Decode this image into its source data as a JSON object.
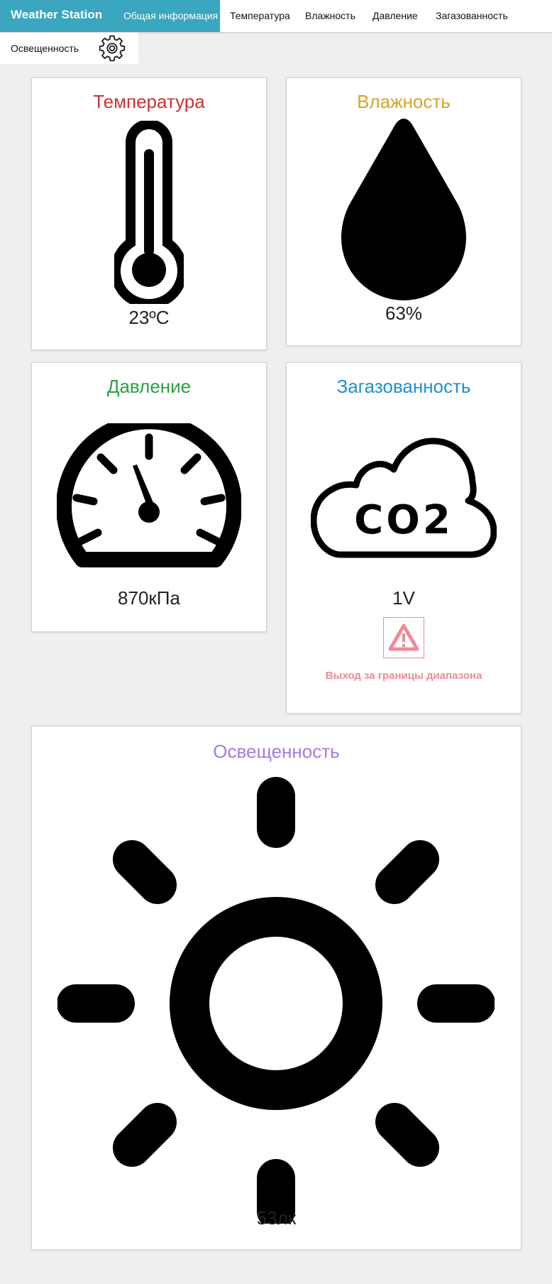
{
  "header": {
    "brand": "Weather Station",
    "nav": [
      {
        "label": "Общая информация",
        "active": true
      },
      {
        "label": "Температура"
      },
      {
        "label": "Влажность"
      },
      {
        "label": "Давление"
      },
      {
        "label": "Загазованность"
      },
      {
        "label": "Освещенность"
      }
    ],
    "settings_icon": "gear-icon"
  },
  "colors": {
    "brand_bg": "#3aa6bf",
    "temperature": "#cc3333",
    "humidity": "#d4a332",
    "pressure": "#2e9e45",
    "gas": "#1e8fd0",
    "light": "#a778e8",
    "warning": "#ef8a97"
  },
  "cards": {
    "temperature": {
      "title": "Температура",
      "value": "23ºC",
      "icon": "thermometer-icon"
    },
    "humidity": {
      "title": "Влажность",
      "value": "63%",
      "icon": "water-drop-icon"
    },
    "pressure": {
      "title": "Давление",
      "value": "870кПа",
      "icon": "gauge-icon"
    },
    "gas": {
      "title": "Загазованность",
      "value": "1V",
      "icon": "co2-cloud-icon",
      "icon_text": "CO2",
      "warning_text": "Выход за границы диапазона",
      "warning_icon": "warning-triangle-icon"
    },
    "light": {
      "title": "Освещенность",
      "value": "53лк",
      "icon": "sun-icon"
    }
  }
}
